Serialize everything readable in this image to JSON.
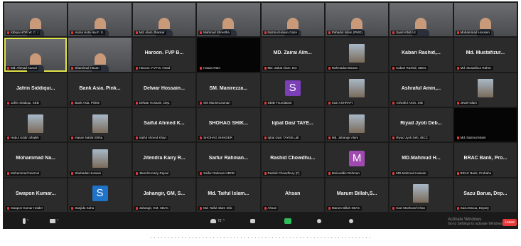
{
  "gallery": {
    "tiles": [
      {
        "kind": "video",
        "center": "",
        "label": "Kibrya HOR W. C. I"
      },
      {
        "kind": "video",
        "center": "",
        "label": "Asma Hota Hai F. S."
      },
      {
        "kind": "video",
        "center": "",
        "label": "Md. Alam Jhankar"
      },
      {
        "kind": "video",
        "center": "",
        "label": "Mahmud Shrestha"
      },
      {
        "kind": "video",
        "center": "",
        "label": "Nazmul Hasan Gaze"
      },
      {
        "kind": "video",
        "center": "",
        "label": "Pahadul Islam (PMO)"
      },
      {
        "kind": "video",
        "center": "",
        "label": "Syed Aftab Ul"
      },
      {
        "kind": "video",
        "center": "",
        "label": "Mohammad Hossain"
      },
      {
        "kind": "video",
        "active": true,
        "center": "",
        "label": "Md. Ahmad Kamal"
      },
      {
        "kind": "video",
        "center": "",
        "label": "Shamimul Hasan"
      },
      {
        "kind": "name",
        "center": "Haroon. FVP B...",
        "label": "Haroon. FVP B. Head"
      },
      {
        "kind": "dark",
        "center": "",
        "label": "Hasan Ram"
      },
      {
        "kind": "name",
        "center": "MD. Zairai Alm...",
        "label": "MD. Zakat Alam. DG"
      },
      {
        "kind": "photo",
        "center": "",
        "label": "Rahmadut Biswas"
      },
      {
        "kind": "name",
        "center": "Kabari Rashid,...",
        "label": "Kabari Rashid, SBOL"
      },
      {
        "kind": "name",
        "center": "Md. Mustafizur...",
        "label": "Md. Mustafizur Rahm."
      },
      {
        "kind": "name",
        "center": "Jafrin Siddiqui...",
        "label": "Jafrin Siddiqui, SEB"
      },
      {
        "kind": "name",
        "center": "Bank Asia. Pink...",
        "label": "Bank Asia. Pinkie"
      },
      {
        "kind": "name",
        "center": "Delwar Hossain...",
        "label": "Delwar Hossain, Dep."
      },
      {
        "kind": "name",
        "center": "SM. Manirezza...",
        "label": "SM Manirezzaman"
      },
      {
        "kind": "avatar",
        "avatar": "S",
        "color": "#7b3fb8",
        "center": "",
        "label": "SBIB Foundation"
      },
      {
        "kind": "photo",
        "center": "",
        "label": "Kazi ASHRAFI"
      },
      {
        "kind": "name",
        "center": "Ashraful Amin,...",
        "label": "Ashraful Amin, SIB"
      },
      {
        "kind": "photo",
        "center": "",
        "label": "Jewel Islam"
      },
      {
        "kind": "photo",
        "center": "",
        "label": "Habul Uddin Shaikh"
      },
      {
        "kind": "photo",
        "center": "",
        "label": "Hasan Nahid Shiha"
      },
      {
        "kind": "name",
        "center": "Saiful Ahmed K...",
        "label": "Saiful Ahmed Khan"
      },
      {
        "kind": "name",
        "center": "SHOHAG SHIK...",
        "label": "SHOHAG SHIKDER"
      },
      {
        "kind": "name",
        "center": "Iqbal Das/ TAYE...",
        "label": "Iqbal Das/ TAYEB Lab"
      },
      {
        "kind": "photo",
        "center": "",
        "label": "Md. Jahangir Alam"
      },
      {
        "kind": "name",
        "center": "Riyad Jyoti Deb...",
        "label": "Riyad Jyoti Deb, IBCC"
      },
      {
        "kind": "dark",
        "center": "",
        "label": "Md. Nazmul Islam"
      },
      {
        "kind": "name",
        "center": "Mohammad Na...",
        "label": "Mohammad Nazmul"
      },
      {
        "kind": "photo",
        "center": "",
        "label": "Shahadat Hossain"
      },
      {
        "kind": "name",
        "center": "Jitendra Kairy R...",
        "label": "Jitendra Kairy Rejaul"
      },
      {
        "kind": "name",
        "center": "Saifur Rahman...",
        "label": "Saifur Rahman HBCB"
      },
      {
        "kind": "name",
        "center": "Rashid Chowdhu...",
        "label": "Rashid Chowdhury (F)"
      },
      {
        "kind": "avatar",
        "avatar": "M",
        "color": "#a04ab0",
        "center": "",
        "label": "Moinuddin Rehman"
      },
      {
        "kind": "name",
        "center": "MD.Mahmud H...",
        "label": "MD.Mahmud Hassan"
      },
      {
        "kind": "name",
        "center": "BRAC Bank, Pro...",
        "label": "BRAC Bank, Probaho"
      },
      {
        "kind": "name",
        "center": "Swapon Kumar...",
        "label": "Swapon Kumar Halder"
      },
      {
        "kind": "avatar",
        "avatar": "S",
        "color": "#1f73c9",
        "center": "",
        "label": "Sanjida Saha"
      },
      {
        "kind": "name",
        "center": "Jahangir, GM, S...",
        "label": "Jahangir, GM, SBAC"
      },
      {
        "kind": "name",
        "center": "Md. Taiful Islam...",
        "label": "Md. Taiful Islam Shir."
      },
      {
        "kind": "name",
        "center": "Ahsan",
        "label": "Ahsan"
      },
      {
        "kind": "name",
        "center": "Marum Billah,S...",
        "label": "Marum Billah SBAC"
      },
      {
        "kind": "photo",
        "center": "",
        "label": "Kazi Musharaf Chan"
      },
      {
        "kind": "name",
        "center": "Sazu Barua, Dep...",
        "label": "Sazu Barua, Deputy"
      }
    ]
  },
  "watermark": {
    "line1": "Activate Windows",
    "line2": "Go to Settings to activate Windows."
  },
  "toolbar": {
    "participants_count": "72",
    "end_label": "Leave"
  },
  "caption": "· · · · · · · · · · · · · · · · · · · · · · · · · · · · · · · · · · · · · · · · · · · · · · · · · · · · · · · · · · · · · · · ·"
}
